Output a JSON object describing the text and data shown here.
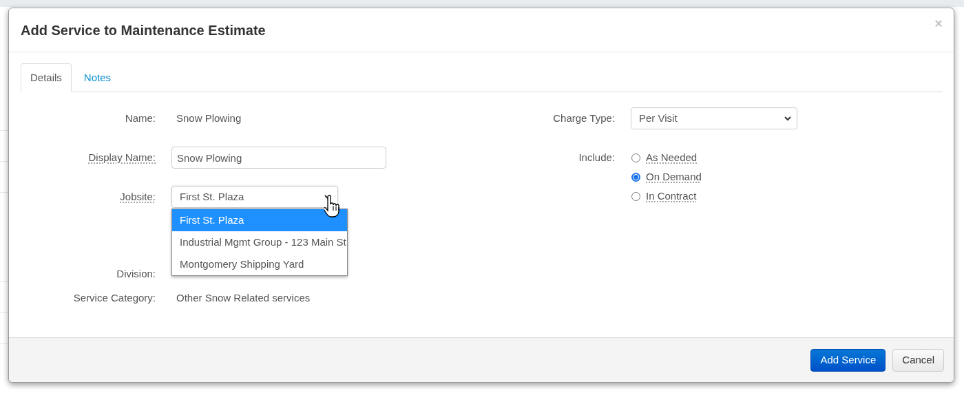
{
  "dialog": {
    "title": "Add Service to Maintenance Estimate",
    "close": "×"
  },
  "tabs": [
    {
      "label": "Details",
      "selected": true
    },
    {
      "label": "Notes",
      "selected": false
    }
  ],
  "left_fields": [
    {
      "kind": "text",
      "label": "Name:",
      "help": false,
      "value": "Snow Plowing"
    },
    {
      "kind": "input",
      "label": "Display Name:",
      "help": true,
      "value": "Snow Plowing"
    },
    {
      "kind": "select",
      "label": "Jobsite:",
      "help": true,
      "value": "First St. Plaza",
      "expanded": true,
      "options": [
        {
          "label": "First St. Plaza",
          "selected": true
        },
        {
          "label": "Industrial Mgmt Group - 123 Main St",
          "selected": false
        },
        {
          "label": "Montgomery Shipping Yard",
          "selected": false
        }
      ]
    },
    {
      "kind": "text",
      "label": "Division:",
      "help": false
    },
    {
      "kind": "text",
      "label": "Service Category:",
      "help": false,
      "value": "Other Snow Related services"
    }
  ],
  "charge_type": {
    "label": "Charge Type:",
    "value": "Per Visit"
  },
  "include": {
    "label": "Include:",
    "options": [
      {
        "label": "As Needed",
        "selected": false
      },
      {
        "label": "On Demand",
        "selected": true
      },
      {
        "label": "In Contract",
        "selected": false
      }
    ]
  },
  "buttons": [
    {
      "kind": "primary",
      "label": "Add Service"
    },
    {
      "kind": "default",
      "label": "Cancel"
    }
  ]
}
